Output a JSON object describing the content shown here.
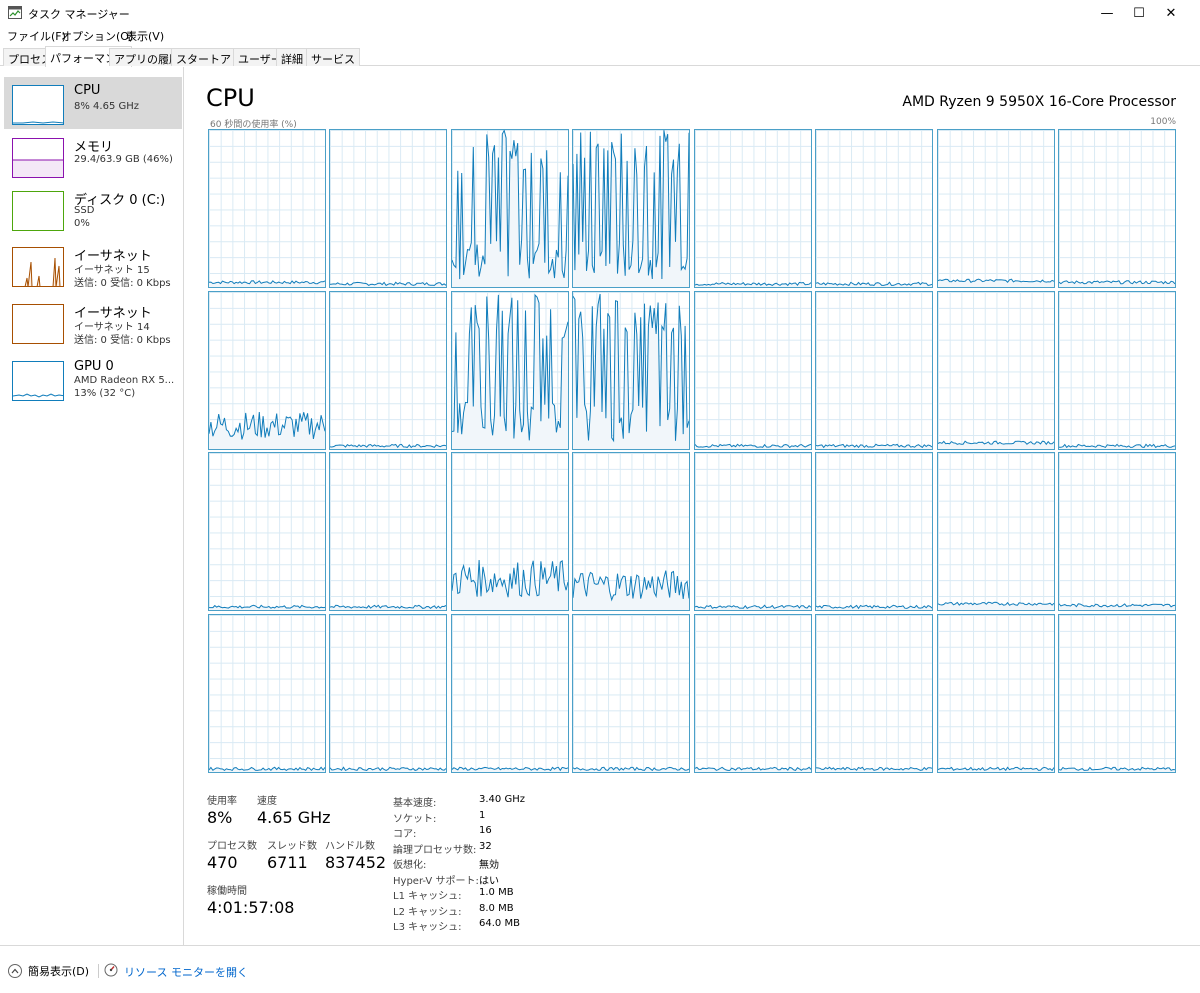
{
  "window": {
    "title": "タスク マネージャー",
    "minimize_glyph": "—",
    "maximize_glyph": "☐",
    "close_glyph": "✕"
  },
  "menu": [
    "ファイル(F)",
    "オプション(O)",
    "表示(V)"
  ],
  "tabs": [
    "プロセス",
    "パフォーマンス",
    "アプリの履歴",
    "スタートアップ",
    "ユーザー",
    "詳細",
    "サービス"
  ],
  "active_tab": "パフォーマンス",
  "sidebar": {
    "items": [
      {
        "name": "CPU",
        "sub1": "8%  4.65 GHz",
        "sub2": "",
        "sub3": "",
        "color": "#117dbb"
      },
      {
        "name": "メモリ",
        "sub1": "29.4/63.9 GB (46%)",
        "sub2": "",
        "sub3": "",
        "color": "#8b12ae"
      },
      {
        "name": "ディスク 0 (C:)",
        "sub1": "SSD",
        "sub2": "0%",
        "sub3": "",
        "color": "#4da60c"
      },
      {
        "name": "イーサネット",
        "sub1": "イーサネット 15",
        "sub2": "送信: 0 受信: 0 Kbps",
        "sub3": "",
        "color": "#a74f01"
      },
      {
        "name": "イーサネット",
        "sub1": "イーサネット 14",
        "sub2": "送信: 0 受信: 0 Kbps",
        "sub3": "",
        "color": "#a74f01"
      },
      {
        "name": "GPU 0",
        "sub1": "AMD Radeon RX 5...",
        "sub2": "13% (32 °C)",
        "sub3": "",
        "color": "#117dbb"
      }
    ]
  },
  "main": {
    "title": "CPU",
    "processor": "AMD Ryzen 9 5950X 16-Core Processor",
    "axis_label": "60 秒間の使用率 (%)",
    "axis_max": "100%"
  },
  "cores": {
    "count": 32,
    "rows": 4,
    "cols": 8,
    "line_color": "#117dbb",
    "fill_color": "#f1f6fa",
    "levels_percent": [
      3,
      2,
      60,
      60,
      2,
      2,
      4,
      3,
      15,
      2,
      55,
      55,
      2,
      2,
      4,
      2,
      2,
      2,
      20,
      16,
      2,
      2,
      4,
      3,
      2,
      2,
      2,
      2,
      2,
      2,
      2,
      2
    ]
  },
  "stats": {
    "usage_label": "使用率",
    "usage_value": "8%",
    "speed_label": "速度",
    "speed_value": "4.65 GHz",
    "process_label": "プロセス数",
    "process_value": "470",
    "thread_label": "スレッド数",
    "thread_value": "6711",
    "handle_label": "ハンドル数",
    "handle_value": "837452",
    "uptime_label": "稼働時間",
    "uptime_value": "4:01:57:08"
  },
  "specs": [
    {
      "key": "基本速度:",
      "value": "3.40 GHz"
    },
    {
      "key": "ソケット:",
      "value": "1"
    },
    {
      "key": "コア:",
      "value": "16"
    },
    {
      "key": "論理プロセッサ数:",
      "value": "32"
    },
    {
      "key": "仮想化:",
      "value": "無効"
    },
    {
      "key": "Hyper-V サポート:",
      "value": "はい"
    },
    {
      "key": "L1 キャッシュ:",
      "value": "1.0 MB"
    },
    {
      "key": "L2 キャッシュ:",
      "value": "8.0 MB"
    },
    {
      "key": "L3 キャッシュ:",
      "value": "64.0 MB"
    }
  ],
  "footer": {
    "compact_label": "簡易表示(D)",
    "resource_monitor_label": "リソース モニターを開く"
  }
}
